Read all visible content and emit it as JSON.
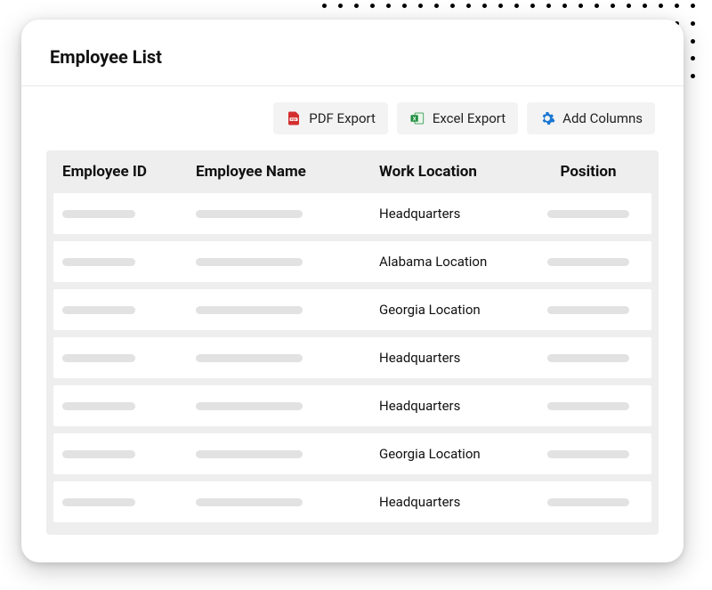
{
  "title": "Employee List",
  "toolbar": {
    "pdf_label": "PDF Export",
    "excel_label": "Excel Export",
    "add_columns_label": "Add Columns"
  },
  "table": {
    "columns": {
      "employee_id": "Employee ID",
      "employee_name": "Employee Name",
      "work_location": "Work Location",
      "position": "Position"
    },
    "rows": [
      {
        "work_location": "Headquarters"
      },
      {
        "work_location": "Alabama Location"
      },
      {
        "work_location": "Georgia Location"
      },
      {
        "work_location": "Headquarters"
      },
      {
        "work_location": "Headquarters"
      },
      {
        "work_location": "Georgia Location"
      },
      {
        "work_location": "Headquarters"
      }
    ]
  },
  "icons": {
    "pdf_color": "#d32f2f",
    "excel_color": "#1e8e3e",
    "gear_color": "#1976d2"
  }
}
